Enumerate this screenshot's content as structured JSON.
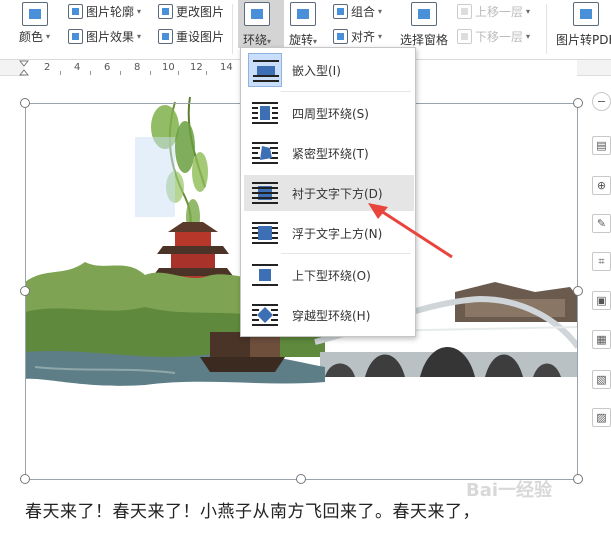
{
  "ribbon": {
    "color_label": "颜色",
    "outline_label": "图片轮廓",
    "effect_label": "图片效果",
    "change_label": "更改图片",
    "reset_label": "重设图片",
    "wrap_label": "环绕",
    "rotate_label": "旋转",
    "group_label": "组合",
    "align_label": "对齐",
    "selpane_label": "选择窗格",
    "bring_forward_label": "上移一层",
    "send_backward_label": "下移一层",
    "to_pdf_label": "图片转PDF"
  },
  "ruler": {
    "numbers": [
      "2",
      "4",
      "6",
      "8",
      "10",
      "12",
      "14"
    ]
  },
  "wrap_menu": {
    "items": [
      {
        "label": "嵌入型(I)",
        "state": "checked"
      },
      {
        "label": "四周型环绕(S)",
        "state": "normal"
      },
      {
        "label": "紧密型环绕(T)",
        "state": "normal"
      },
      {
        "label": "衬于文字下方(D)",
        "state": "highlighted"
      },
      {
        "label": "浮于文字上方(N)",
        "state": "normal"
      },
      {
        "label": "上下型环绕(O)",
        "state": "normal"
      },
      {
        "label": "穿越型环绕(H)",
        "state": "normal"
      }
    ]
  },
  "document": {
    "body_text": "春天来了！春天来了！小燕子从南方飞回来了。春天来了，"
  },
  "watermark": "Bai一经验",
  "colors": {
    "accent": "#4a90d9",
    "arrow": "#e8453c",
    "menu_highlight": "#e5e5e5"
  }
}
